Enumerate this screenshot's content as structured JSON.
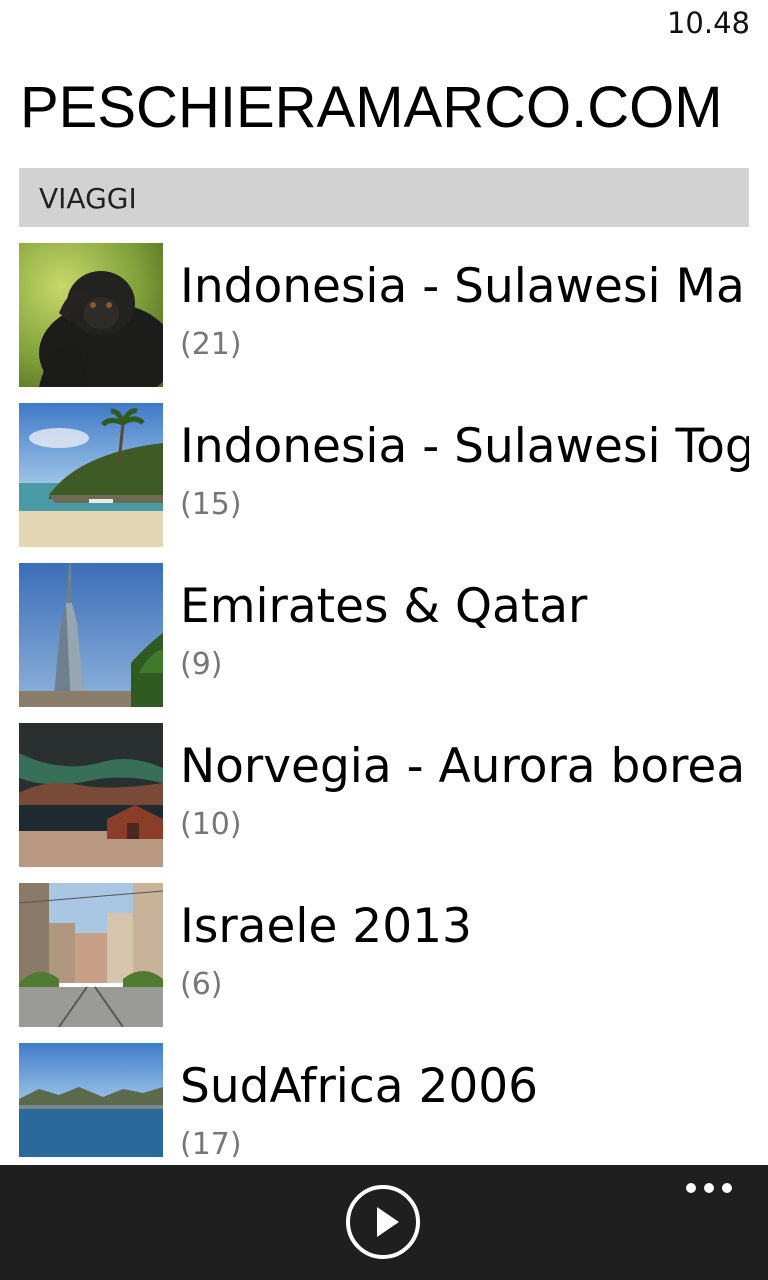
{
  "status_bar": {
    "time": "10.48"
  },
  "app": {
    "title": "PESCHIERAMARCO.COM"
  },
  "section": {
    "label": "VIAGGI"
  },
  "albums": [
    {
      "title": "Indonesia - Sulawesi Manado",
      "count": "(21)",
      "thumb_icon": "macaque-photo"
    },
    {
      "title": "Indonesia - Sulawesi Togian",
      "count": "(15)",
      "thumb_icon": "beach-island-photo"
    },
    {
      "title": "Emirates & Qatar",
      "count": "(9)",
      "thumb_icon": "skyscraper-photo"
    },
    {
      "title": "Norvegia - Aurora boreale",
      "count": "(10)",
      "thumb_icon": "aurora-cabin-photo"
    },
    {
      "title": "Israele 2013",
      "count": "(6)",
      "thumb_icon": "city-street-photo"
    },
    {
      "title": "SudAfrica 2006",
      "count": "(17)",
      "thumb_icon": "bay-mountains-photo"
    }
  ],
  "app_bar": {
    "play_icon": "play-icon",
    "more_icon": "more-dots-icon"
  },
  "colors": {
    "section_header_bg": "#d2d2d2",
    "app_bar_bg": "#1f1f1f",
    "count_text": "#777777"
  }
}
